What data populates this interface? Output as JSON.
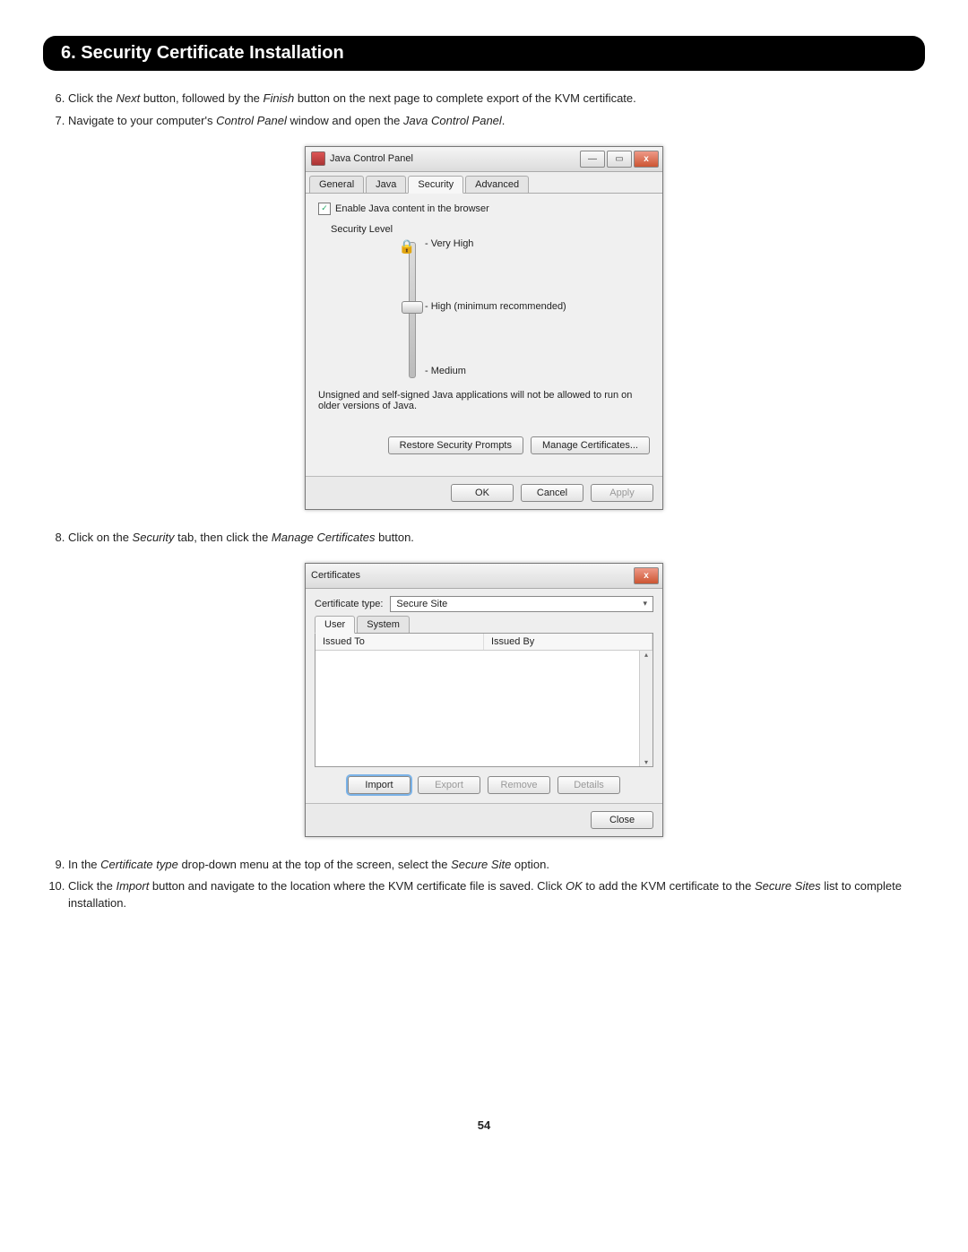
{
  "section": {
    "title": "6. Security Certificate Installation"
  },
  "steps": {
    "s6_num": "6.",
    "s6_a": "Click the ",
    "s6_next": "Next",
    "s6_b": " button, followed by the ",
    "s6_finish": "Finish",
    "s6_c": " button on the next page to complete export of the KVM certificate.",
    "s7_num": "7.",
    "s7_a": "Navigate to your computer's ",
    "s7_cp": "Control Panel",
    "s7_b": " window and open the ",
    "s7_jcp": "Java Control Panel",
    "s7_c": ".",
    "s8_num": "8.",
    "s8_a": "Click on the ",
    "s8_sec": "Security",
    "s8_b": " tab, then click the ",
    "s8_mc": "Manage Certificates",
    "s8_c": " button.",
    "s9_num": "9.",
    "s9_a": "In the ",
    "s9_ct": "Certificate type",
    "s9_b": " drop-down menu at the top of the screen, select the ",
    "s9_ss": "Secure Site",
    "s9_c": " option.",
    "s10_num": "10.",
    "s10_a": "Click the ",
    "s10_imp": "Import",
    "s10_b": " button and navigate to the location where the KVM certificate file is saved. Click ",
    "s10_ok": "OK",
    "s10_c": " to add the KVM certificate to the ",
    "s10_ssl": "Secure Sites",
    "s10_d": " list to complete installation."
  },
  "java": {
    "title": "Java Control Panel",
    "tabs": {
      "general": "General",
      "java": "Java",
      "security": "Security",
      "advanced": "Advanced"
    },
    "enable": "Enable Java content in the browser",
    "seclevel_label": "Security Level",
    "levels": {
      "veryhigh": "Very High",
      "high": "High (minimum recommended)",
      "medium": "Medium"
    },
    "note": "Unsigned and self-signed Java applications will not be allowed to run on older versions of Java.",
    "restore": "Restore Security Prompts",
    "manage": "Manage Certificates...",
    "ok": "OK",
    "cancel": "Cancel",
    "apply": "Apply"
  },
  "cert": {
    "title": "Certificates",
    "type_label": "Certificate type:",
    "type_value": "Secure Site",
    "tabs": {
      "user": "User",
      "system": "System"
    },
    "cols": {
      "to": "Issued To",
      "by": "Issued By"
    },
    "import": "Import",
    "export": "Export",
    "remove": "Remove",
    "details": "Details",
    "close": "Close"
  },
  "winbtns": {
    "min": "—",
    "max": "▭",
    "close": "x"
  },
  "icons": {
    "lock": "🔒",
    "dd": "▾",
    "up": "▴",
    "down": "▾",
    "check": "✓"
  },
  "page": "54"
}
